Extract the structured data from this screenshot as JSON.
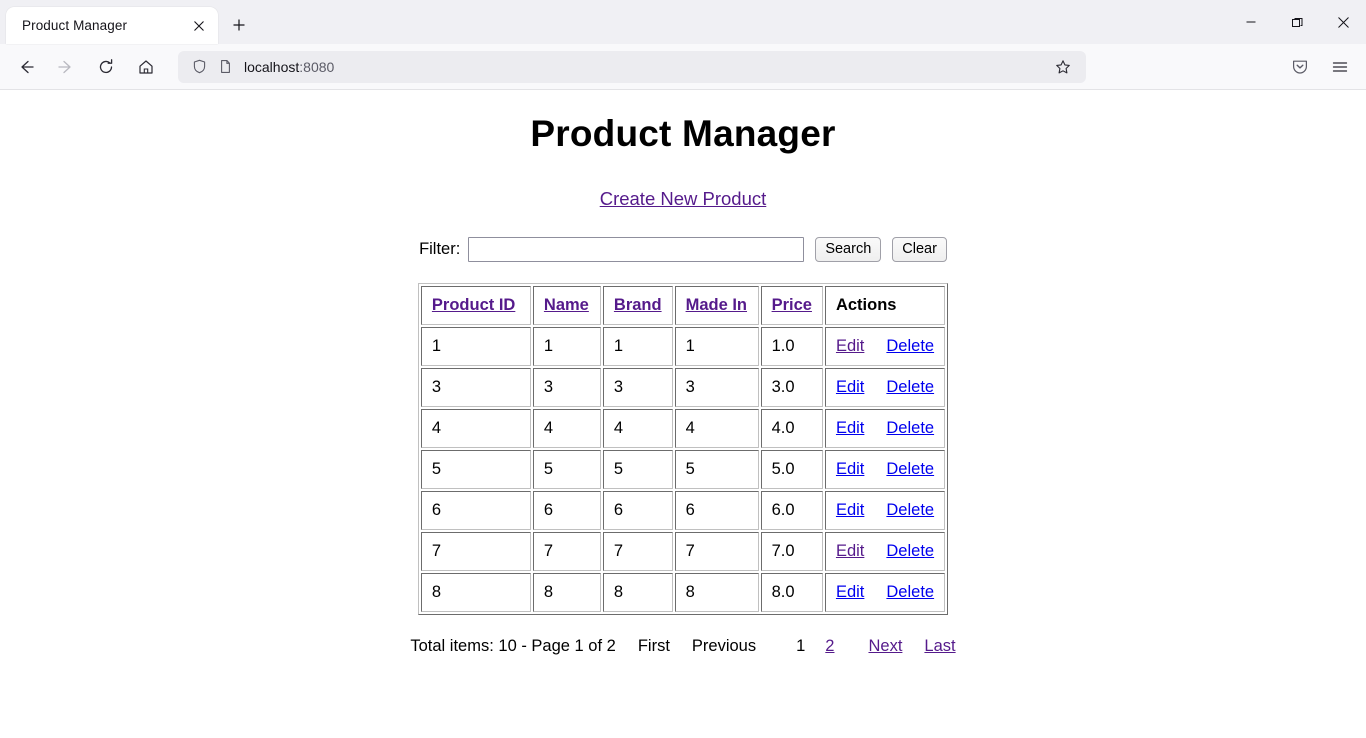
{
  "browser": {
    "tab": {
      "title": "Product Manager",
      "close_icon": "close-icon",
      "newtab_icon": "plus-icon"
    },
    "window_controls": {
      "minimize": "minimize-icon",
      "restore": "restore-icon",
      "close": "close-icon"
    },
    "toolbar": {
      "back": "back-arrow-icon",
      "forward": "forward-arrow-icon",
      "reload": "reload-icon",
      "home": "home-icon",
      "shield": "shield-icon",
      "page": "page-icon",
      "bookmark": "star-icon",
      "pocket": "pocket-icon",
      "menu": "hamburger-menu-icon"
    },
    "url": {
      "host": "localhost",
      "port": ":8080"
    }
  },
  "page": {
    "title": "Product Manager",
    "create_link": "Create New Product",
    "filter": {
      "label": "Filter:",
      "value": "",
      "placeholder": "",
      "search_button": "Search",
      "clear_button": "Clear"
    },
    "table": {
      "headers": [
        {
          "label": "Product ID",
          "sortable": true
        },
        {
          "label": "Name",
          "sortable": true
        },
        {
          "label": "Brand",
          "sortable": true
        },
        {
          "label": "Made In",
          "sortable": true
        },
        {
          "label": "Price",
          "sortable": true
        },
        {
          "label": "Actions",
          "sortable": false
        }
      ],
      "actions": {
        "edit": "Edit",
        "delete": "Delete"
      },
      "rows": [
        {
          "id": "1",
          "name": "1",
          "brand": "1",
          "made_in": "1",
          "price": "1.0",
          "edit_visited": true
        },
        {
          "id": "3",
          "name": "3",
          "brand": "3",
          "made_in": "3",
          "price": "3.0",
          "edit_visited": false
        },
        {
          "id": "4",
          "name": "4",
          "brand": "4",
          "made_in": "4",
          "price": "4.0",
          "edit_visited": false
        },
        {
          "id": "5",
          "name": "5",
          "brand": "5",
          "made_in": "5",
          "price": "5.0",
          "edit_visited": false
        },
        {
          "id": "6",
          "name": "6",
          "brand": "6",
          "made_in": "6",
          "price": "6.0",
          "edit_visited": false
        },
        {
          "id": "7",
          "name": "7",
          "brand": "7",
          "made_in": "7",
          "price": "7.0",
          "edit_visited": true
        },
        {
          "id": "8",
          "name": "8",
          "brand": "8",
          "made_in": "8",
          "price": "8.0",
          "edit_visited": false
        }
      ]
    },
    "pagination": {
      "summary": "Total items: 10 - Page 1 of 2",
      "total_items": 10,
      "current_page": 1,
      "total_pages": 2,
      "first": "First",
      "previous": "Previous",
      "page_numbers": [
        {
          "label": "1",
          "active": true
        },
        {
          "label": "2",
          "active": false
        }
      ],
      "next": "Next",
      "last": "Last"
    }
  },
  "colors": {
    "link_visited": "#551a8b",
    "link_unvisited": "#0000ee",
    "chrome_titlebar": "#f0f0f4",
    "chrome_navbar": "#f9f9fb",
    "urlbar_bg": "#ececf0"
  }
}
